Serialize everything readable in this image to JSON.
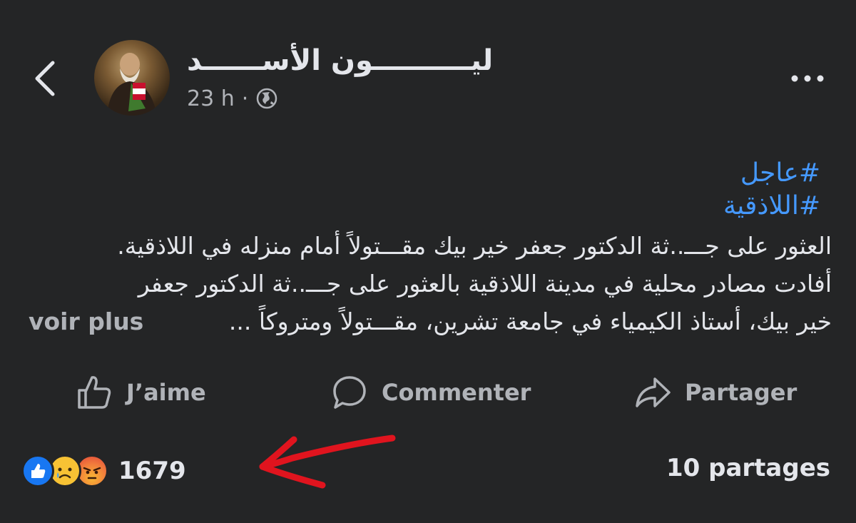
{
  "post": {
    "author": "ليــــــــــون الأســــــد",
    "time": "23 h",
    "separator": "·",
    "visibility_icon": "globe-icon",
    "hashtags": [
      "#عاجل",
      "#اللاذقية"
    ],
    "lines": [
      "العثور على جـــ..ثة الدكتور جعفر خير بيك مقـــتولاً أمام منزله في اللاذقية.",
      "أفادت مصادر محلية في مدينة اللاذقية بالعثور على جـــ..ثة الدكتور جعفر",
      "خير بيك، أستاذ الكيمياء في جامعة تشرين، مقـــتولاً ومتروكاً ..."
    ],
    "see_more": "voir plus"
  },
  "actions": {
    "like": "J’aime",
    "comment": "Commenter",
    "share": "Partager"
  },
  "stats": {
    "reaction_icons": [
      "like-reaction-icon",
      "sad-reaction-icon",
      "angry-reaction-icon"
    ],
    "reaction_count": "1679",
    "shares": "10 partages"
  },
  "colors": {
    "background": "#242526",
    "hashtag": "#4599ff",
    "annotation_arrow": "#e0141e",
    "like_blue": "#1877f2"
  }
}
